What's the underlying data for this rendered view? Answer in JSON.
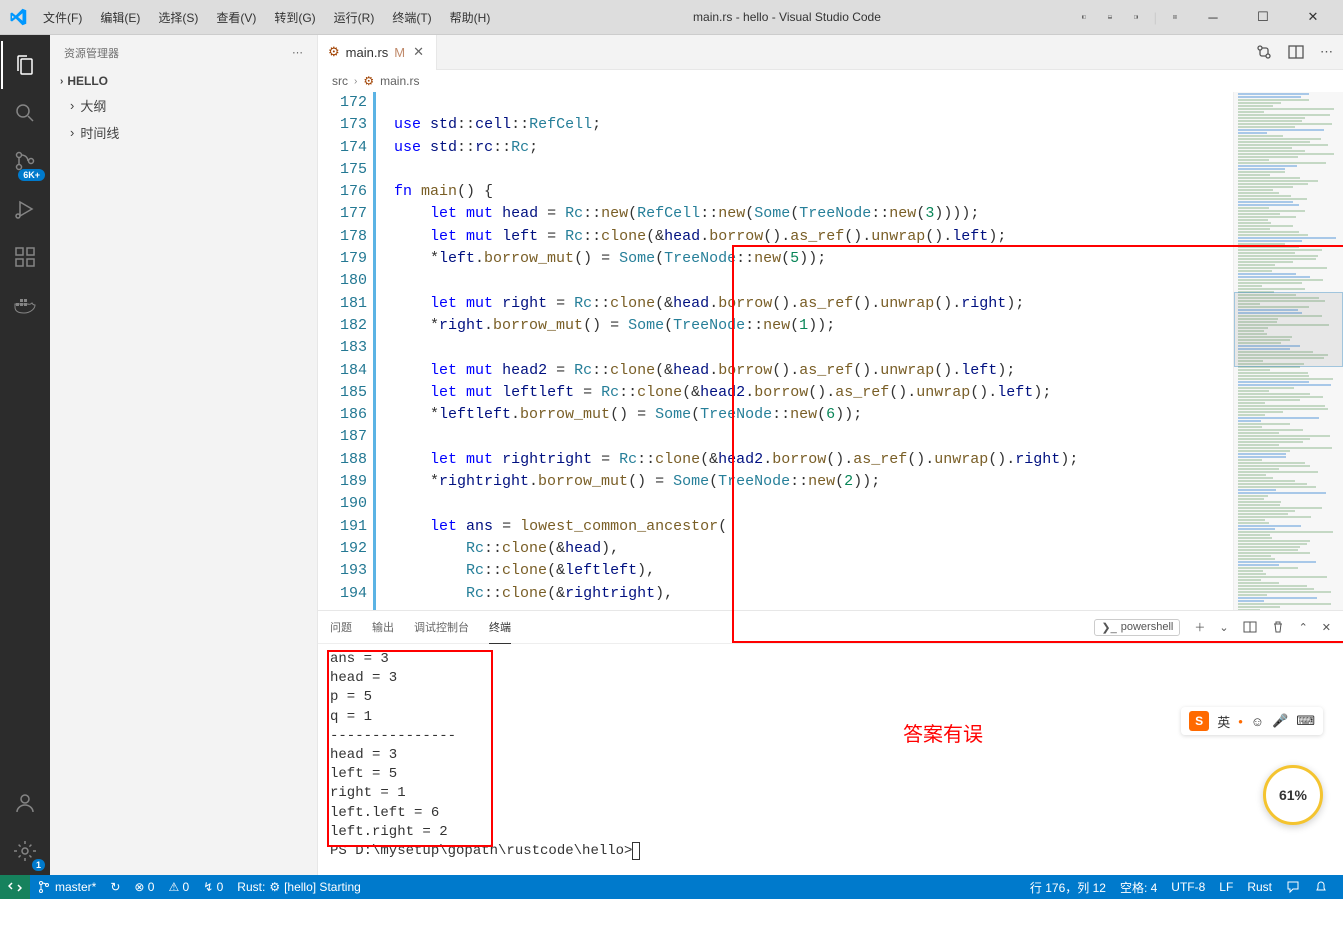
{
  "title": "main.rs - hello - Visual Studio Code",
  "menu": [
    "文件(F)",
    "编辑(E)",
    "选择(S)",
    "查看(V)",
    "转到(G)",
    "运行(R)",
    "终端(T)",
    "帮助(H)"
  ],
  "activity_badge": "6K+",
  "sidebar": {
    "header": "资源管理器",
    "sections": [
      {
        "label": "HELLO",
        "expanded": false
      },
      {
        "label": "大纲",
        "expanded": false
      },
      {
        "label": "时间线",
        "expanded": false
      }
    ]
  },
  "tab": {
    "name": "main.rs",
    "modified": "M"
  },
  "breadcrumb": [
    "src",
    "main.rs"
  ],
  "line_start": 172,
  "code_lines": [
    "",
    "<span class='kw'>use</span> <span class='id'>std</span>::<span class='id'>cell</span>::<span class='ty'>RefCell</span>;",
    "<span class='kw'>use</span> <span class='id'>std</span>::<span class='id'>rc</span>::<span class='ty'>Rc</span>;",
    "",
    "<span class='kw'>fn</span> <span class='fn'>main</span>() {",
    "    <span class='kw'>let</span> <span class='kw'>mut</span> <span class='id'>head</span> = <span class='ty'>Rc</span>::<span class='fn'>new</span>(<span class='ty'>RefCell</span>::<span class='fn'>new</span>(<span class='ty'>Some</span>(<span class='ty'>TreeNode</span>::<span class='fn'>new</span>(<span class='num'>3</span>))));",
    "    <span class='kw'>let</span> <span class='kw'>mut</span> <span class='id'>left</span> = <span class='ty'>Rc</span>::<span class='fn'>clone</span>(&<span class='id'>head</span>.<span class='fn'>borrow</span>().<span class='fn'>as_ref</span>().<span class='fn'>unwrap</span>().<span class='id'>left</span>);",
    "    *<span class='id'>left</span>.<span class='fn'>borrow_mut</span>() = <span class='ty'>Some</span>(<span class='ty'>TreeNode</span>::<span class='fn'>new</span>(<span class='num'>5</span>));",
    "",
    "    <span class='kw'>let</span> <span class='kw'>mut</span> <span class='id'>right</span> = <span class='ty'>Rc</span>::<span class='fn'>clone</span>(&<span class='id'>head</span>.<span class='fn'>borrow</span>().<span class='fn'>as_ref</span>().<span class='fn'>unwrap</span>().<span class='id'>right</span>);",
    "    *<span class='id'>right</span>.<span class='fn'>borrow_mut</span>() = <span class='ty'>Some</span>(<span class='ty'>TreeNode</span>::<span class='fn'>new</span>(<span class='num'>1</span>));",
    "",
    "    <span class='kw'>let</span> <span class='kw'>mut</span> <span class='id'>head2</span> = <span class='ty'>Rc</span>::<span class='fn'>clone</span>(&<span class='id'>head</span>.<span class='fn'>borrow</span>().<span class='fn'>as_ref</span>().<span class='fn'>unwrap</span>().<span class='id'>left</span>);",
    "    <span class='kw'>let</span> <span class='kw'>mut</span> <span class='id'>leftleft</span> = <span class='ty'>Rc</span>::<span class='fn'>clone</span>(&<span class='id'>head2</span>.<span class='fn'>borrow</span>().<span class='fn'>as_ref</span>().<span class='fn'>unwrap</span>().<span class='id'>left</span>);",
    "    *<span class='id'>leftleft</span>.<span class='fn'>borrow_mut</span>() = <span class='ty'>Some</span>(<span class='ty'>TreeNode</span>::<span class='fn'>new</span>(<span class='num'>6</span>));",
    "",
    "    <span class='kw'>let</span> <span class='kw'>mut</span> <span class='id'>rightright</span> = <span class='ty'>Rc</span>::<span class='fn'>clone</span>(&<span class='id'>head2</span>.<span class='fn'>borrow</span>().<span class='fn'>as_ref</span>().<span class='fn'>unwrap</span>().<span class='id'>right</span>);",
    "    *<span class='id'>rightright</span>.<span class='fn'>borrow_mut</span>() = <span class='ty'>Some</span>(<span class='ty'>TreeNode</span>::<span class='fn'>new</span>(<span class='num'>2</span>));",
    "",
    "    <span class='kw'>let</span> <span class='id'>ans</span> = <span class='fn'>lowest_common_ancestor</span>(",
    "        <span class='ty'>Rc</span>::<span class='fn'>clone</span>(&<span class='id'>head</span>),",
    "        <span class='ty'>Rc</span>::<span class='fn'>clone</span>(&<span class='id'>leftleft</span>),",
    "        <span class='ty'>Rc</span>::<span class='fn'>clone</span>(&<span class='id'>rightright</span>),"
  ],
  "panel": {
    "tabs": [
      "问题",
      "输出",
      "调试控制台",
      "终端"
    ],
    "active_tab": 3,
    "terminal_type": "powershell",
    "output_lines": [
      "ans = 3",
      "head = 3",
      "p = 5",
      "q = 1",
      "---------------",
      "head = 3",
      "left = 5",
      "right = 1",
      "left.left = 6",
      "left.right = 2"
    ],
    "prompt": "PS D:\\mysetup\\gopath\\rustcode\\hello> "
  },
  "annotation": "答案有误",
  "status": {
    "branch": "master*",
    "sync": "↻",
    "errors": "⊗ 0",
    "warnings": "⚠ 0",
    "port": "↯ 0",
    "rust_label": "Rust:",
    "rust_status": "[hello] Starting",
    "pos": "行 176，列 12",
    "spaces": "空格: 4",
    "encoding": "UTF-8",
    "eol": "LF",
    "lang": "Rust"
  },
  "ime": {
    "lang": "英",
    "sep": "•"
  },
  "progress": "61%"
}
